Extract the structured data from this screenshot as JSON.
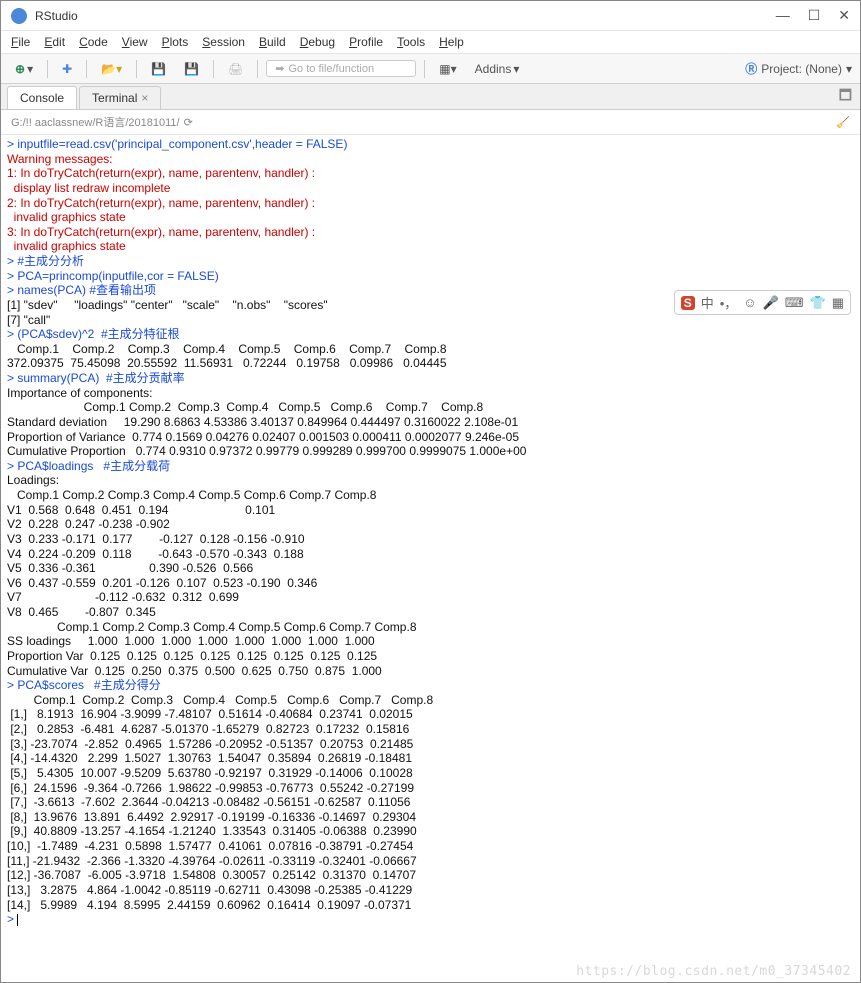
{
  "window": {
    "title": "RStudio",
    "min": "—",
    "max": "☐",
    "close": "✕"
  },
  "menu": {
    "file": "File",
    "edit": "Edit",
    "code": "Code",
    "view": "View",
    "plots": "Plots",
    "session": "Session",
    "build": "Build",
    "debug": "Debug",
    "profile": "Profile",
    "tools": "Tools",
    "help": "Help"
  },
  "toolbar": {
    "goto_placeholder": "Go to file/function",
    "addins": "Addins",
    "project": "Project: (None)"
  },
  "tabs": {
    "console": "Console",
    "terminal": "Terminal"
  },
  "crumb": {
    "path": "G:/!! aaclassnew/R语言/20181011/"
  },
  "sogou": {
    "lang": "中"
  },
  "watermark": "https://blog.csdn.net/m0_37345402",
  "console_lines": [
    {
      "cls": "c-blue",
      "t": "> inputfile=read.csv('principal_component.csv',header = FALSE)"
    },
    {
      "cls": "c-red",
      "t": "Warning messages:"
    },
    {
      "cls": "c-red",
      "t": "1: In doTryCatch(return(expr), name, parentenv, handler) :"
    },
    {
      "cls": "c-red",
      "t": "  display list redraw incomplete"
    },
    {
      "cls": "c-red",
      "t": "2: In doTryCatch(return(expr), name, parentenv, handler) :"
    },
    {
      "cls": "c-red",
      "t": "  invalid graphics state"
    },
    {
      "cls": "c-red",
      "t": "3: In doTryCatch(return(expr), name, parentenv, handler) :"
    },
    {
      "cls": "c-red",
      "t": "  invalid graphics state"
    },
    {
      "cls": "c-blue",
      "t": "> #主成分分析"
    },
    {
      "cls": "c-blue",
      "t": "> PCA=princomp(inputfile,cor = FALSE)"
    },
    {
      "cls": "c-blue",
      "t": "> names(PCA) #查看输出项"
    },
    {
      "cls": "c-black",
      "t": "[1] \"sdev\"     \"loadings\" \"center\"   \"scale\"    \"n.obs\"    \"scores\"  "
    },
    {
      "cls": "c-black",
      "t": "[7] \"call\"    "
    },
    {
      "cls": "c-blue",
      "t": "> (PCA$sdev)^2  #主成分特征根"
    },
    {
      "cls": "c-black",
      "t": "   Comp.1    Comp.2    Comp.3    Comp.4    Comp.5    Comp.6    Comp.7    Comp.8 "
    },
    {
      "cls": "c-black",
      "t": "372.09375  75.45098  20.55592  11.56931   0.72244   0.19758   0.09986   0.04445 "
    },
    {
      "cls": "c-blue",
      "t": "> summary(PCA)  #主成分贡献率"
    },
    {
      "cls": "c-black",
      "t": "Importance of components:"
    },
    {
      "cls": "c-black",
      "t": "                       Comp.1 Comp.2  Comp.3  Comp.4   Comp.5   Comp.6    Comp.7    Comp.8"
    },
    {
      "cls": "c-black",
      "t": "Standard deviation     19.290 8.6863 4.53386 3.40137 0.849964 0.444497 0.3160022 2.108e-01"
    },
    {
      "cls": "c-black",
      "t": "Proportion of Variance  0.774 0.1569 0.04276 0.02407 0.001503 0.000411 0.0002077 9.246e-05"
    },
    {
      "cls": "c-black",
      "t": "Cumulative Proportion   0.774 0.9310 0.97372 0.99779 0.999289 0.999700 0.9999075 1.000e+00"
    },
    {
      "cls": "c-blue",
      "t": "> PCA$loadings   #主成分载荷"
    },
    {
      "cls": "c-black",
      "t": ""
    },
    {
      "cls": "c-black",
      "t": "Loadings:"
    },
    {
      "cls": "c-black",
      "t": "   Comp.1 Comp.2 Comp.3 Comp.4 Comp.5 Comp.6 Comp.7 Comp.8"
    },
    {
      "cls": "c-black",
      "t": "V1  0.568  0.648  0.451  0.194                       0.101"
    },
    {
      "cls": "c-black",
      "t": "V2  0.228  0.247 -0.238 -0.902                            "
    },
    {
      "cls": "c-black",
      "t": "V3  0.233 -0.171  0.177        -0.127  0.128 -0.156 -0.910"
    },
    {
      "cls": "c-black",
      "t": "V4  0.224 -0.209  0.118        -0.643 -0.570 -0.343  0.188"
    },
    {
      "cls": "c-black",
      "t": "V5  0.336 -0.361                0.390 -0.526  0.566       "
    },
    {
      "cls": "c-black",
      "t": "V6  0.437 -0.559  0.201 -0.126  0.107  0.523 -0.190  0.346"
    },
    {
      "cls": "c-black",
      "t": "V7                      -0.112 -0.632  0.312  0.699       "
    },
    {
      "cls": "c-black",
      "t": "V8  0.465        -0.807  0.345                            "
    },
    {
      "cls": "c-black",
      "t": ""
    },
    {
      "cls": "c-black",
      "t": "               Comp.1 Comp.2 Comp.3 Comp.4 Comp.5 Comp.6 Comp.7 Comp.8"
    },
    {
      "cls": "c-black",
      "t": "SS loadings     1.000  1.000  1.000  1.000  1.000  1.000  1.000  1.000"
    },
    {
      "cls": "c-black",
      "t": "Proportion Var  0.125  0.125  0.125  0.125  0.125  0.125  0.125  0.125"
    },
    {
      "cls": "c-black",
      "t": "Cumulative Var  0.125  0.250  0.375  0.500  0.625  0.750  0.875  1.000"
    },
    {
      "cls": "c-blue",
      "t": "> PCA$scores   #主成分得分"
    },
    {
      "cls": "c-black",
      "t": "        Comp.1  Comp.2  Comp.3   Comp.4   Comp.5   Comp.6   Comp.7   Comp.8"
    },
    {
      "cls": "c-black",
      "t": " [1,]   8.1913  16.904 -3.9099 -7.48107  0.51614 -0.40684  0.23741  0.02015"
    },
    {
      "cls": "c-black",
      "t": " [2,]   0.2853  -6.481  4.6287 -5.01370 -1.65279  0.82723  0.17232  0.15816"
    },
    {
      "cls": "c-black",
      "t": " [3,] -23.7074  -2.852  0.4965  1.57286 -0.20952 -0.51357  0.20753  0.21485"
    },
    {
      "cls": "c-black",
      "t": " [4,] -14.4320   2.299  1.5027  1.30763  1.54047  0.35894  0.26819 -0.18481"
    },
    {
      "cls": "c-black",
      "t": " [5,]   5.4305  10.007 -9.5209  5.63780 -0.92197  0.31929 -0.14006  0.10028"
    },
    {
      "cls": "c-black",
      "t": " [6,]  24.1596  -9.364 -0.7266  1.98622 -0.99853 -0.76773  0.55242 -0.27199"
    },
    {
      "cls": "c-black",
      "t": " [7,]  -3.6613  -7.602  2.3644 -0.04213 -0.08482 -0.56151 -0.62587  0.11056"
    },
    {
      "cls": "c-black",
      "t": " [8,]  13.9676  13.891  6.4492  2.92917 -0.19199 -0.16336 -0.14697  0.29304"
    },
    {
      "cls": "c-black",
      "t": " [9,]  40.8809 -13.257 -4.1654 -1.21240  1.33543  0.31405 -0.06388  0.23990"
    },
    {
      "cls": "c-black",
      "t": "[10,]  -1.7489  -4.231  0.5898  1.57477  0.41061  0.07816 -0.38791 -0.27454"
    },
    {
      "cls": "c-black",
      "t": "[11,] -21.9432  -2.366 -1.3320 -4.39764 -0.02611 -0.33119 -0.32401 -0.06667"
    },
    {
      "cls": "c-black",
      "t": "[12,] -36.7087  -6.005 -3.9718  1.54808  0.30057  0.25142  0.31370  0.14707"
    },
    {
      "cls": "c-black",
      "t": "[13,]   3.2875   4.864 -1.0042 -0.85119 -0.62711  0.43098 -0.25385 -0.41229"
    },
    {
      "cls": "c-black",
      "t": "[14,]   5.9989   4.194  8.5995  2.44159  0.60962  0.16414  0.19097 -0.07371"
    },
    {
      "cls": "c-blue",
      "t": "> "
    }
  ]
}
